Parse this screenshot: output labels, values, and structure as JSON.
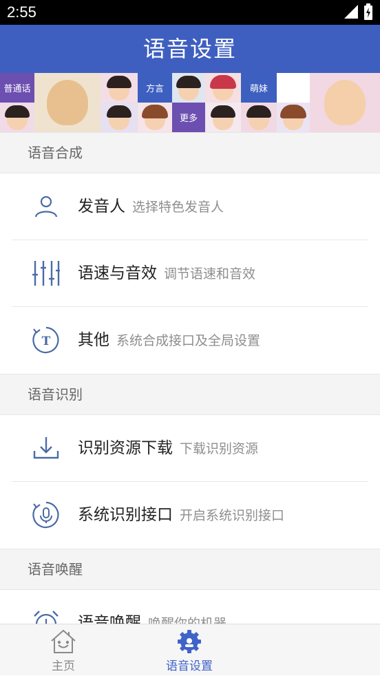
{
  "status_bar": {
    "time": "2:55",
    "signal_icon": "signal-icon",
    "battery_icon": "battery-icon"
  },
  "app_bar": {
    "title": "语音设置"
  },
  "banner": {
    "labels": {
      "putonghua": "普通话",
      "fangyan": "方言",
      "mengmei": "萌妹",
      "gengduo": "更多"
    },
    "colors": {
      "purple": "#6c4fb0",
      "blue": "#3d5fc0",
      "bg": "#ece3f2"
    }
  },
  "sections": {
    "synthesis": {
      "header": "语音合成",
      "items": [
        {
          "title": "发音人",
          "subtitle": "选择特色发音人",
          "icon": "person-icon"
        },
        {
          "title": "语速与音效",
          "subtitle": "调节语速和音效",
          "icon": "sliders-icon"
        },
        {
          "title": "其他",
          "subtitle": "系统合成接口及全局设置",
          "icon": "text-refresh-icon"
        }
      ]
    },
    "recognition": {
      "header": "语音识别",
      "items": [
        {
          "title": "识别资源下载",
          "subtitle": "下载识别资源",
          "icon": "download-icon"
        },
        {
          "title": "系统识别接口",
          "subtitle": "开启系统识别接口",
          "icon": "mic-refresh-icon"
        }
      ]
    },
    "wakeup": {
      "header": "语音唤醒",
      "items": [
        {
          "title": "语音唤醒",
          "subtitle": "唤醒你的机器",
          "icon": "alarm-icon"
        }
      ]
    }
  },
  "bottom_nav": {
    "home": {
      "label": "主页",
      "icon": "home-icon"
    },
    "settings": {
      "label": "语音设置",
      "icon": "gear-icon"
    }
  },
  "colors": {
    "primary": "#3f5fc0",
    "icon": "#4a6aa8",
    "active": "#3f63c8",
    "inactive": "#888888"
  }
}
